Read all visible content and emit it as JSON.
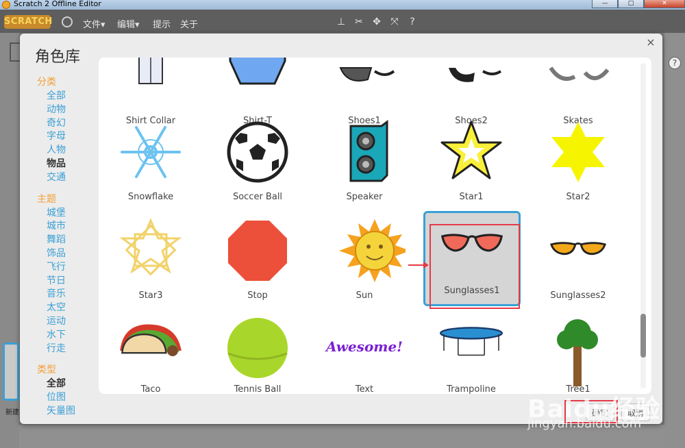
{
  "window": {
    "title": "Scratch 2 Offline Editor",
    "buttons": [
      "—",
      "□",
      "✕"
    ]
  },
  "menubar": {
    "logo": "SCRATCH",
    "menus": [
      "文件▾",
      "编辑▾",
      "提示",
      "关于"
    ]
  },
  "dialog": {
    "title": "角色库",
    "close": "×",
    "sidebar": {
      "category_heading": "分类",
      "categories": [
        "全部",
        "动物",
        "奇幻",
        "字母",
        "人物",
        "物品",
        "交通"
      ],
      "theme_heading": "主题",
      "themes": [
        "城堡",
        "城市",
        "舞蹈",
        "饰品",
        "飞行",
        "节日",
        "音乐",
        "太空",
        "运动",
        "水下",
        "行走"
      ],
      "type_heading": "类型",
      "types": [
        "全部",
        "位图",
        "矢量图"
      ]
    },
    "sprites": [
      "Shirt Collar",
      "Shirt-T",
      "Shoes1",
      "Shoes2",
      "Skates",
      "Snowflake",
      "Soccer Ball",
      "Speaker",
      "Star1",
      "Star2",
      "Star3",
      "Stop",
      "Sun",
      "Sunglasses1",
      "Sunglasses2",
      "Taco",
      "Tennis Ball",
      "Text",
      "Trampoline",
      "Tree1"
    ],
    "selected_sprite": "Sunglasses1",
    "text_sprite_art": "Awesome!",
    "buttons": {
      "ok": "确定",
      "cancel": "取消"
    },
    "background_label": "新建"
  },
  "watermark": {
    "brand": "Baidu经验",
    "url": "jingyan.baidu.com"
  },
  "colors": {
    "accent": "#3aa0d6",
    "section": "#f2a03a",
    "annotation": "#e63946"
  }
}
